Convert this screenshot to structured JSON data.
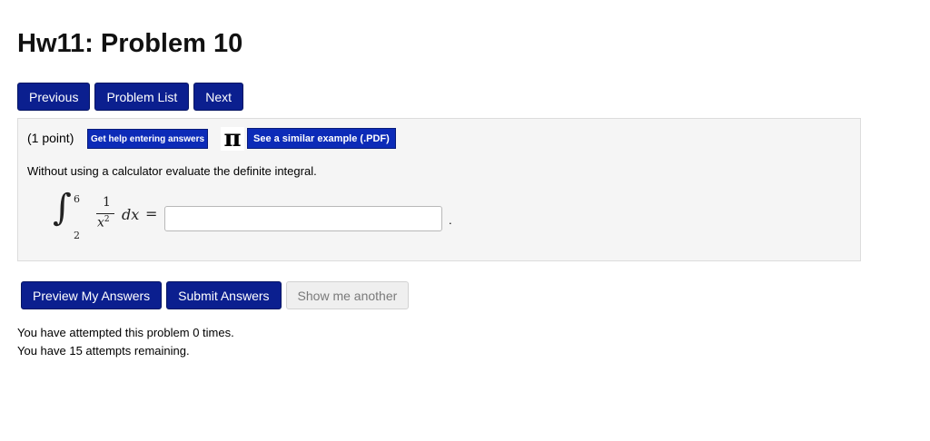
{
  "page": {
    "title": "Hw11: Problem 10"
  },
  "nav": {
    "previous": "Previous",
    "problem_list": "Problem List",
    "next": "Next"
  },
  "problem": {
    "points": "(1 point)",
    "help_button": "Get help entering answers",
    "pi_icon": "π",
    "example_button": "See a similar example (.PDF)",
    "instruction": "Without using a calculator evaluate the definite integral.",
    "integral": {
      "upper_limit": "6",
      "lower_limit": "2",
      "numerator": "1",
      "denominator_base": "x",
      "denominator_exp": "2",
      "differential": "dx",
      "equals": "="
    },
    "answer": {
      "value": "",
      "placeholder": ""
    },
    "trailing": "."
  },
  "actions": {
    "preview": "Preview My Answers",
    "submit": "Submit Answers",
    "show_another": "Show me another"
  },
  "status": {
    "attempted": "You have attempted this problem 0 times.",
    "remaining": "You have 15 attempts remaining."
  },
  "colors": {
    "primary_button": "#0b1f8f",
    "help_button": "#0c2bb8",
    "panel_bg": "#f5f5f5"
  }
}
